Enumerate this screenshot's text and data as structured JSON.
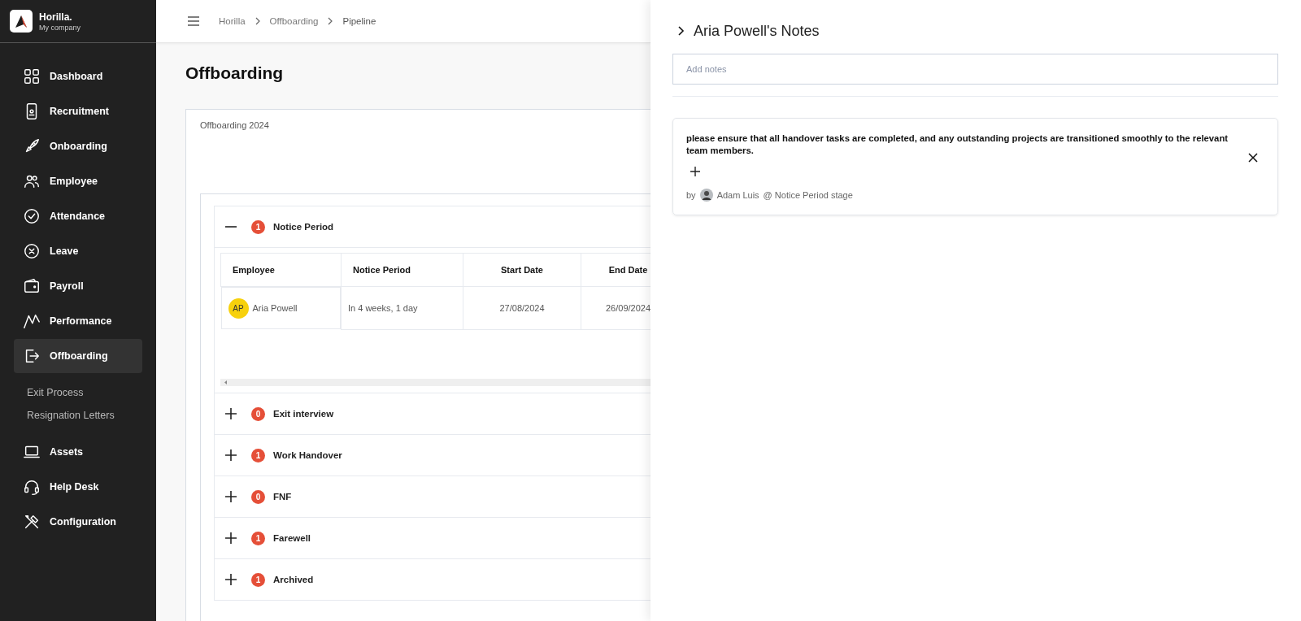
{
  "sidebar": {
    "brand": {
      "name": "Horilla.",
      "company": "My company"
    },
    "items": [
      {
        "label": "Dashboard",
        "selected": false
      },
      {
        "label": "Recruitment",
        "selected": false
      },
      {
        "label": "Onboarding",
        "selected": false
      },
      {
        "label": "Employee",
        "selected": false
      },
      {
        "label": "Attendance",
        "selected": false
      },
      {
        "label": "Leave",
        "selected": false
      },
      {
        "label": "Payroll",
        "selected": false
      },
      {
        "label": "Performance",
        "selected": false
      },
      {
        "label": "Offboarding",
        "selected": true,
        "children": [
          {
            "label": "Exit Process"
          },
          {
            "label": "Resignation Letters"
          }
        ]
      },
      {
        "label": "Assets",
        "selected": false
      },
      {
        "label": "Help Desk",
        "selected": false
      },
      {
        "label": "Configuration",
        "selected": false
      }
    ]
  },
  "breadcrumb": [
    "Horilla",
    "Offboarding",
    "Pipeline"
  ],
  "page_title": "Offboarding",
  "pipeline": {
    "title": "Offboarding 2024",
    "stages": [
      {
        "name": "Notice Period",
        "count": "1",
        "expanded": true,
        "table": {
          "columns": [
            "Employee",
            "Notice Period",
            "Start Date",
            "End Date"
          ],
          "rows": [
            {
              "initials": "AP",
              "name": "Aria Powell",
              "notice_period": "In 4 weeks, 1 day",
              "start_date": "27/08/2024",
              "end_date": "26/09/2024"
            }
          ]
        }
      },
      {
        "name": "Exit interview",
        "count": "0",
        "expanded": false
      },
      {
        "name": "Work Handover",
        "count": "1",
        "expanded": false
      },
      {
        "name": "FNF",
        "count": "0",
        "expanded": false
      },
      {
        "name": "Farewell",
        "count": "1",
        "expanded": false
      },
      {
        "name": "Archived",
        "count": "1",
        "expanded": false
      }
    ]
  },
  "notes_panel": {
    "title": "Aria Powell's Notes",
    "placeholder": "Add notes",
    "notes": [
      {
        "text": "please ensure that all handover tasks are completed, and any outstanding projects are transitioned smoothly to the relevant team members.",
        "by_label": "by",
        "author": "Adam Luis",
        "context": "@ Notice Period stage"
      }
    ]
  }
}
